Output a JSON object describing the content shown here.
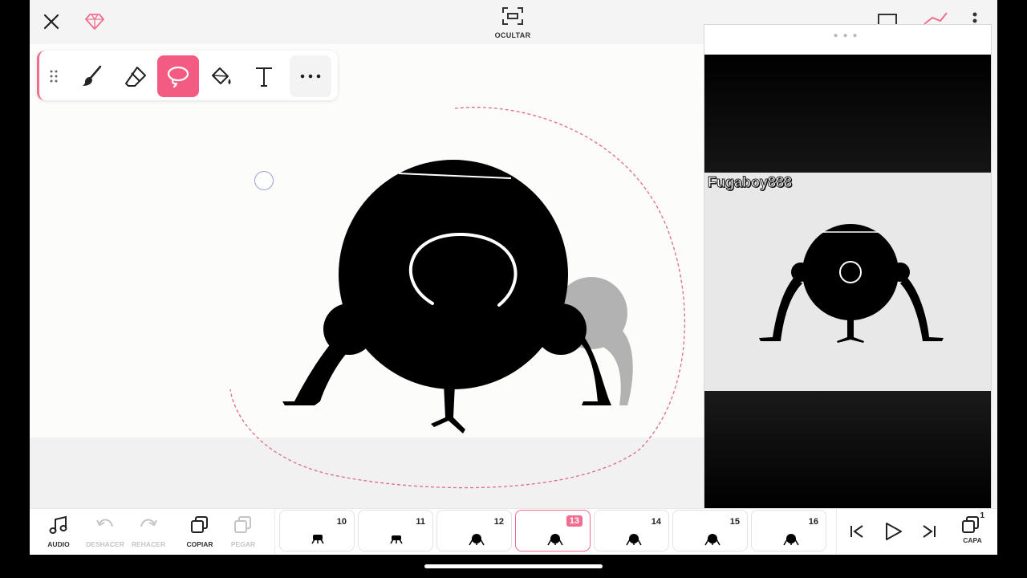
{
  "header": {
    "hide_label": "OCULTAR"
  },
  "toolbar": {
    "tools": [
      {
        "name": "grip-icon"
      },
      {
        "name": "brush-icon"
      },
      {
        "name": "eraser-icon"
      },
      {
        "name": "lasso-icon",
        "active": true
      },
      {
        "name": "paint-bucket-icon"
      },
      {
        "name": "text-icon",
        "glyph": "T"
      },
      {
        "name": "more-icon",
        "glyph": "•••"
      }
    ]
  },
  "preview": {
    "watermark": "Fugaboy888"
  },
  "bottom": {
    "audio_label": "AUDIO",
    "undo_label": "DESHACER",
    "redo_label": "REHACER",
    "copy_label": "COPIAR",
    "paste_label": "PEGAR",
    "layer_label": "CAPA",
    "layer_count": "1",
    "frames": [
      {
        "num": "10"
      },
      {
        "num": "11"
      },
      {
        "num": "12"
      },
      {
        "num": "13",
        "active": true
      },
      {
        "num": "14"
      },
      {
        "num": "15"
      },
      {
        "num": "16"
      }
    ]
  },
  "colors": {
    "accent": "#f45b82",
    "accent_border": "#f06d8f"
  }
}
